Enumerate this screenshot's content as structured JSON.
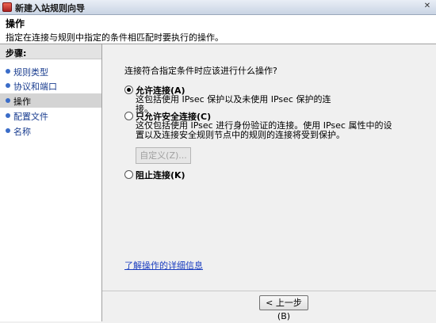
{
  "window": {
    "title": "新建入站规则向导",
    "close_glyph": "✕"
  },
  "header": {
    "title": "操作",
    "description": "指定在连接与规则中指定的条件相匹配时要执行的操作。"
  },
  "sidebar": {
    "steps_label": "步骤:",
    "items": [
      {
        "label": "规则类型",
        "active": false
      },
      {
        "label": "协议和端口",
        "active": false
      },
      {
        "label": "操作",
        "active": true
      },
      {
        "label": "配置文件",
        "active": false
      },
      {
        "label": "名称",
        "active": false
      }
    ]
  },
  "main": {
    "question": "连接符合指定条件时应该进行什么操作?",
    "options": [
      {
        "label": "允许连接(A)",
        "description": "这包括使用 IPsec 保护以及未使用 IPsec 保护的连接。",
        "selected": true
      },
      {
        "label": "只允许安全连接(C)",
        "description": "这仅包括使用 IPsec 进行身份验证的连接。使用 IPsec 属性中的设置以及连接安全规则节点中的规则的连接将受到保护。",
        "selected": false
      },
      {
        "label": "阻止连接(K)",
        "selected": false
      }
    ],
    "customize_button": "自定义(Z)...",
    "learn_more_link": "了解操作的详细信息"
  },
  "footer": {
    "back_button": "< 上一步(B)"
  }
}
